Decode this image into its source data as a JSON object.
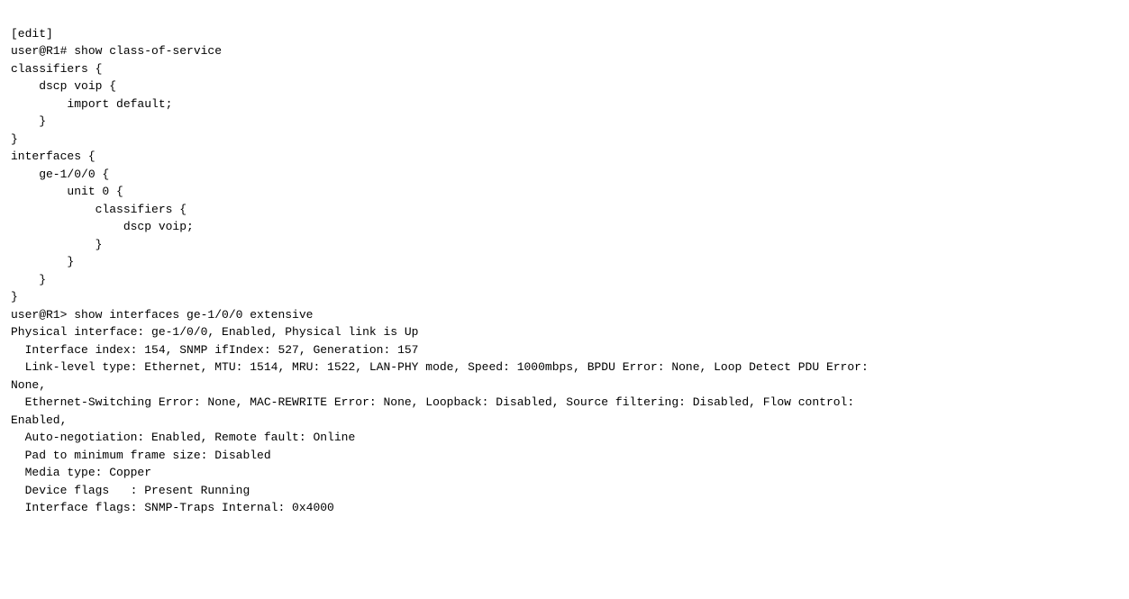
{
  "terminal": {
    "lines": [
      "[edit]",
      "user@R1# show class-of-service",
      "classifiers {",
      "    dscp voip {",
      "        import default;",
      "    }",
      "}",
      "interfaces {",
      "    ge-1/0/0 {",
      "        unit 0 {",
      "            classifiers {",
      "                dscp voip;",
      "            }",
      "        }",
      "    }",
      "}",
      "user@R1> show interfaces ge-1/0/0 extensive",
      "Physical interface: ge-1/0/0, Enabled, Physical link is Up",
      "  Interface index: 154, SNMP ifIndex: 527, Generation: 157",
      "  Link-level type: Ethernet, MTU: 1514, MRU: 1522, LAN-PHY mode, Speed: 1000mbps, BPDU Error: None, Loop Detect PDU Error:",
      "None,",
      "  Ethernet-Switching Error: None, MAC-REWRITE Error: None, Loopback: Disabled, Source filtering: Disabled, Flow control:",
      "Enabled,",
      "  Auto-negotiation: Enabled, Remote fault: Online",
      "  Pad to minimum frame size: Disabled",
      "  Media type: Copper",
      "  Device flags   : Present Running",
      "  Interface flags: SNMP-Traps Internal: 0x4000"
    ]
  }
}
